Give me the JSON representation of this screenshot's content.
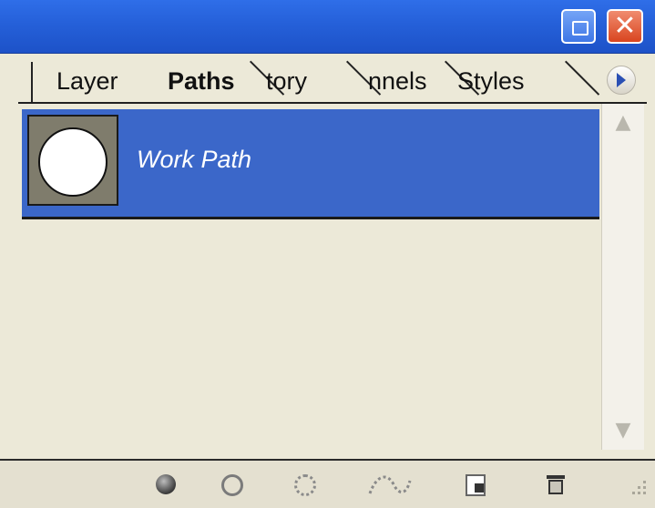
{
  "window": {
    "buttons": {
      "minimize_icon": "minimize-icon",
      "close_icon": "close-icon",
      "close_glyph": "✕"
    }
  },
  "tabs": [
    {
      "label": "Layer",
      "active": false
    },
    {
      "label": "Paths",
      "active": true
    },
    {
      "label": "tory",
      "active": false
    },
    {
      "label": "nnels",
      "active": false
    },
    {
      "label": "Styles",
      "active": false
    }
  ],
  "panel_menu_icon": "triangle-right-icon",
  "paths": [
    {
      "name": "Work Path",
      "selected": true,
      "italic": true,
      "thumbnail": "circle-path-thumbnail"
    }
  ],
  "bottom_toolbar": {
    "icons": [
      "fill-path-icon",
      "stroke-path-icon",
      "load-selection-icon",
      "make-work-path-icon",
      "new-path-icon",
      "delete-path-icon"
    ]
  },
  "colors": {
    "titlebar": "#2560d9",
    "selection": "#3b67c9",
    "panel_bg": "#ece9d8",
    "close_button": "#d9451f"
  }
}
